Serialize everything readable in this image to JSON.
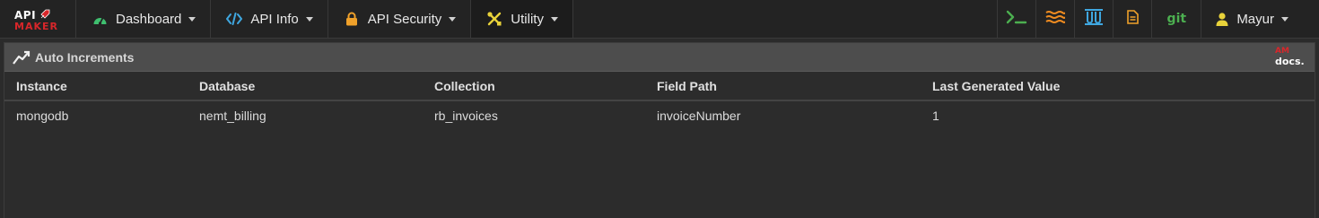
{
  "logo": {
    "line1": "API",
    "line2": "MAKER"
  },
  "nav": {
    "menus": [
      {
        "label": "Dashboard",
        "icon": "dashboard-gauge-icon"
      },
      {
        "label": "API Info",
        "icon": "code-icon"
      },
      {
        "label": "API Security",
        "icon": "lock-icon"
      },
      {
        "label": "Utility",
        "icon": "tools-icon"
      }
    ],
    "tools": {
      "terminal": "terminal-icon",
      "stream": "stream-icon",
      "test": "test-tubes-icon",
      "docs": "document-icon",
      "git_label": "git"
    },
    "user": {
      "name": "Mayur",
      "icon": "user-icon"
    }
  },
  "panel": {
    "title": "Auto Increments",
    "docs_badge": {
      "top": "AM",
      "bottom": "docs."
    },
    "table": {
      "headers": [
        "Instance",
        "Database",
        "Collection",
        "Field Path",
        "Last Generated Value"
      ],
      "rows": [
        [
          "mongodb",
          "nemt_billing",
          "rb_invoices",
          "invoiceNumber",
          "1"
        ]
      ]
    }
  },
  "colors": {
    "navbar": "#232323",
    "panel_header": "#4d4d4d",
    "body": "#2b2b2b",
    "dashboard_icon": "#3fbf6f",
    "code_icon": "#3fa7e0",
    "lock_icon": "#f0a12a",
    "tools_icon": "#e8d23a",
    "terminal_icon": "#4caf50",
    "stream_icon": "#f08c20",
    "test_icon": "#3fa7e0",
    "doc_icon": "#f0a12a",
    "git": "#4caf50",
    "user_icon": "#e8d23a",
    "brand_red": "#d8262a"
  }
}
